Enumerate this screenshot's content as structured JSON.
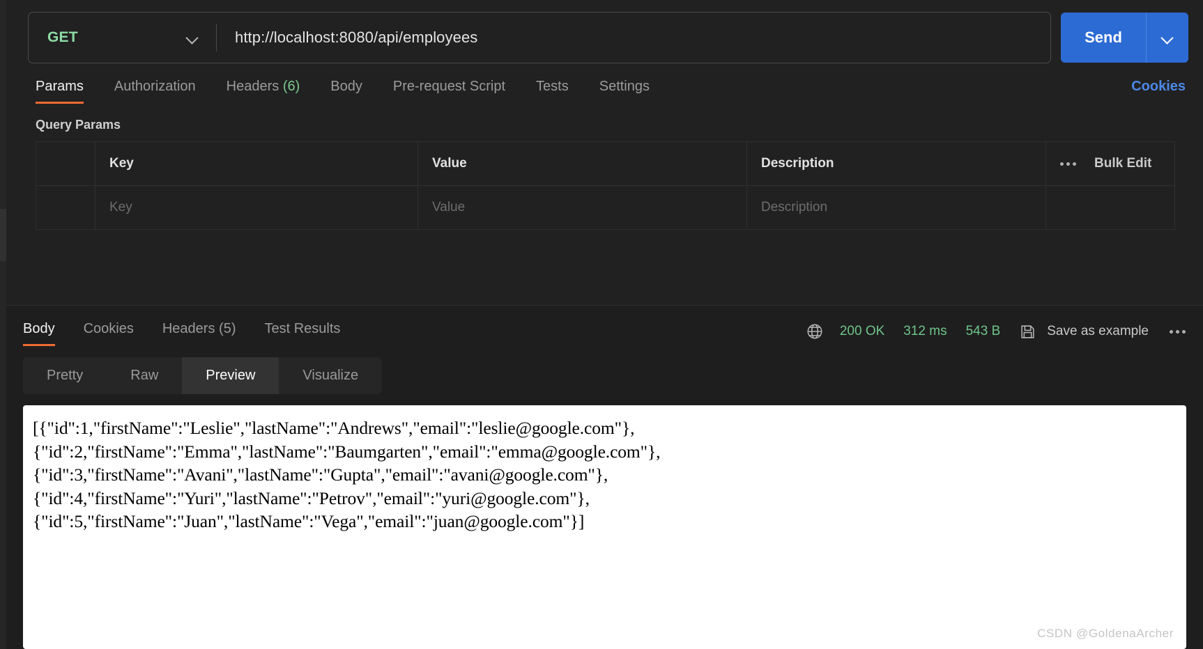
{
  "request": {
    "method": "GET",
    "method_color": "#8ddca4",
    "url": "http://localhost:8080/api/employees",
    "send_label": "Send",
    "send_color": "#2c6bd4",
    "method_chevron_icon": "chevron-down-icon",
    "send_chevron_icon": "chevron-down-icon",
    "tabs": [
      {
        "label": "Params",
        "count": "",
        "active": true
      },
      {
        "label": "Authorization",
        "count": "",
        "active": false
      },
      {
        "label": "Headers",
        "count": "(6)",
        "active": false
      },
      {
        "label": "Body",
        "count": "",
        "active": false
      },
      {
        "label": "Pre-request Script",
        "count": "",
        "active": false
      },
      {
        "label": "Tests",
        "count": "",
        "active": false
      },
      {
        "label": "Settings",
        "count": "",
        "active": false
      }
    ],
    "active_tab_underline_color": "#ef6b33",
    "cookies_link": "Cookies",
    "cookies_link_color": "#4c88e8"
  },
  "query_params": {
    "section_title": "Query Params",
    "columns": [
      "Key",
      "Value",
      "Description"
    ],
    "bulk_edit_label": "Bulk Edit",
    "bulk_edit_icon": "three-dots-icon",
    "empty_row": {
      "key_placeholder": "Key",
      "value_placeholder": "Value",
      "description_placeholder": "Description"
    }
  },
  "response": {
    "tabs": [
      {
        "label": "Body",
        "count": "",
        "active": true
      },
      {
        "label": "Cookies",
        "count": "",
        "active": false
      },
      {
        "label": "Headers",
        "count": "(5)",
        "active": false
      },
      {
        "label": "Test Results",
        "count": "",
        "active": false
      }
    ],
    "status": {
      "globe_icon": "globe-icon",
      "code": "200 OK",
      "time": "312 ms",
      "size": "543 B",
      "color": "#6fc58a"
    },
    "save_icon": "floppy-disk-save-icon",
    "save_label": "Save as example",
    "more_icon": "three-dots-icon",
    "view_modes": [
      {
        "label": "Pretty",
        "active": false
      },
      {
        "label": "Raw",
        "active": false
      },
      {
        "label": "Preview",
        "active": true
      },
      {
        "label": "Visualize",
        "active": false
      }
    ],
    "body_preview": "[{\"id\":1,\"firstName\":\"Leslie\",\"lastName\":\"Andrews\",\"email\":\"leslie@google.com\"},\n{\"id\":2,\"firstName\":\"Emma\",\"lastName\":\"Baumgarten\",\"email\":\"emma@google.com\"},\n{\"id\":3,\"firstName\":\"Avani\",\"lastName\":\"Gupta\",\"email\":\"avani@google.com\"},\n{\"id\":4,\"firstName\":\"Yuri\",\"lastName\":\"Petrov\",\"email\":\"yuri@google.com\"},\n{\"id\":5,\"firstName\":\"Juan\",\"lastName\":\"Vega\",\"email\":\"juan@google.com\"}]"
  },
  "watermark": "CSDN @GoldenaArcher"
}
